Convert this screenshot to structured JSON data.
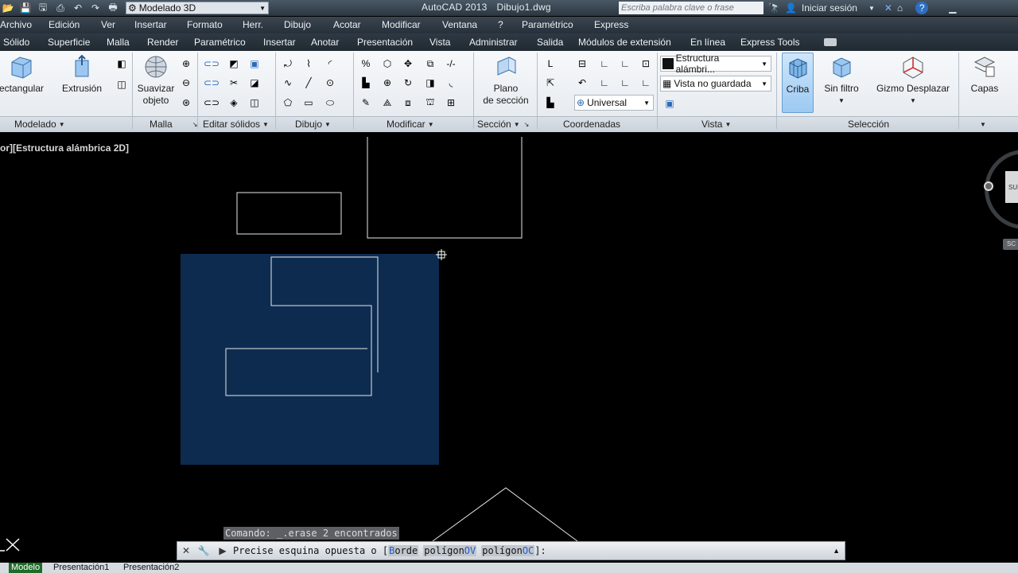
{
  "titlebar": {
    "workspace": "Modelado 3D",
    "app_name": "AutoCAD 2013",
    "file_name": "Dibujo1.dwg",
    "search_placeholder": "Escriba palabra clave o frase",
    "signin": "Iniciar sesión",
    "help": "?"
  },
  "menu": [
    "Archivo",
    "Edición",
    "Ver",
    "Insertar",
    "Formato",
    "Herr.",
    "Dibujo",
    "Acotar",
    "Modificar",
    "Ventana",
    "?",
    "Paramétrico",
    "Express"
  ],
  "tabs": [
    "Sólido",
    "Superficie",
    "Malla",
    "Render",
    "Paramétrico",
    "Insertar",
    "Anotar",
    "Presentación",
    "Vista",
    "Administrar",
    "Salida",
    "Módulos de extensión",
    "En línea",
    "Express Tools"
  ],
  "ribbon": {
    "modelado": {
      "rect": "ectangular",
      "extrusion": "Extrusión",
      "title": "Modelado"
    },
    "malla": {
      "suavizar1": "Suavizar",
      "suavizar2": "objeto",
      "title": "Malla"
    },
    "editar": {
      "title": "Editar sólidos"
    },
    "dibujo": {
      "title": "Dibujo"
    },
    "modificar": {
      "title": "Modificar"
    },
    "seccion": {
      "plano1": "Plano",
      "plano2": "de sección",
      "title": "Sección"
    },
    "coordenadas": {
      "ucs": "Universal",
      "title": "Coordenadas"
    },
    "vista": {
      "style": "Estructura alámbri...",
      "named": "Vista no guardada",
      "title": "Vista"
    },
    "seleccion": {
      "criba": "Criba",
      "filtro": "Sin filtro",
      "gizmo": "Gizmo Desplazar",
      "title": "Selección"
    },
    "capas": {
      "label": "Capas"
    }
  },
  "viewport": {
    "label": "or][Estructura alámbrica 2D]"
  },
  "viewcube": {
    "face": "SUP",
    "wcs": "SC"
  },
  "command": {
    "history": "Comando:  _.erase 2 encontrados",
    "prompt": "Precise esquina opuesta o [",
    "opt1_key": "B",
    "opt1_rest": "orde",
    "opt2_pre": "polígon",
    "opt2_key": "OV",
    "opt3_pre": "polígon",
    "opt3_key": "OC",
    "suffix": "]:"
  },
  "layouts": [
    "Modelo",
    "Presentación1",
    "Presentación2"
  ],
  "colors": {
    "selection": "#0c2c52",
    "tab_active": "#1f6b2a"
  }
}
